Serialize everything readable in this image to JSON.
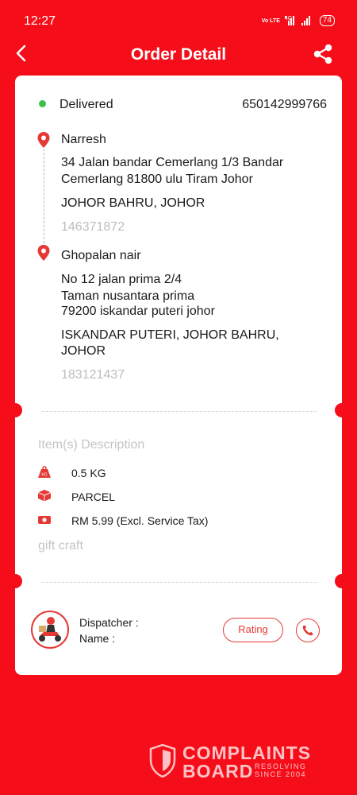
{
  "status_bar": {
    "time": "12:27",
    "volte": "Vo LTE",
    "network": "4G",
    "battery": "74"
  },
  "header": {
    "title": "Order Detail",
    "back_icon": "chevron-left-icon",
    "share_icon": "share-icon"
  },
  "order": {
    "status": "Delivered",
    "status_color": "#3cc04a",
    "number": "650142999766"
  },
  "sender": {
    "name": "Narresh",
    "address": "34 Jalan bandar Cemerlang 1/3 Bandar Cemerlang 81800 ulu Tiram Johor",
    "city": "JOHOR BAHRU, JOHOR",
    "phone": "146371872"
  },
  "receiver": {
    "name": "Ghopalan nair",
    "address_line1": "No 12 jalan prima 2/4",
    "address_line2": "Taman nusantara prima",
    "address_line3": "79200 iskandar puteri johor",
    "city_line1": "ISKANDAR PUTERI, JOHOR BAHRU,",
    "city_line2": "JOHOR",
    "phone": "183121437"
  },
  "items": {
    "section_title": "Item(s) Description",
    "weight": "0.5  KG",
    "type": "PARCEL",
    "price": "RM 5.99 (Excl. Service Tax)",
    "description": "gift craft"
  },
  "dispatcher": {
    "label": "Dispatcher :",
    "name_label": "Name :",
    "rating_label": "Rating",
    "call_icon": "phone-icon"
  },
  "watermark": {
    "line1": "COMPLAINTS",
    "line2": "BOARD",
    "sub1": "RESOLVING",
    "sub2": "SINCE 2004"
  },
  "colors": {
    "brand_red": "#f50e1a",
    "accent_red": "#e53935"
  }
}
